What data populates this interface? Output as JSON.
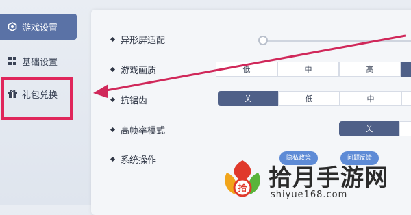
{
  "sidebar": {
    "items": [
      {
        "label": "游戏设置",
        "icon": "hexagon-settings-icon"
      },
      {
        "label": "基础设置",
        "icon": "grid-icon"
      },
      {
        "label": "礼包兑换",
        "icon": "gift-icon"
      }
    ]
  },
  "settings": {
    "shape_adapt": {
      "label": "异形屏适配",
      "slider_value": 0
    },
    "quality": {
      "label": "游戏画质",
      "options": [
        "低",
        "中",
        "高"
      ],
      "selected": ""
    },
    "antialias": {
      "label": "抗锯齿",
      "options": [
        "关",
        "低",
        "中"
      ],
      "selected": "关"
    },
    "high_fps": {
      "label": "高帧率模式",
      "options": [
        "关"
      ],
      "selected": "关"
    },
    "system_ops": {
      "label": "系统操作",
      "buttons": [
        "隐私政策",
        "问题反馈"
      ]
    }
  },
  "watermark": {
    "title": "拾月手游网",
    "url": "shiyue168.com"
  },
  "colors": {
    "accent": "#4f6088",
    "highlight": "#e0265b",
    "arrow": "#d0285a",
    "pill": "#5e8bd6"
  }
}
